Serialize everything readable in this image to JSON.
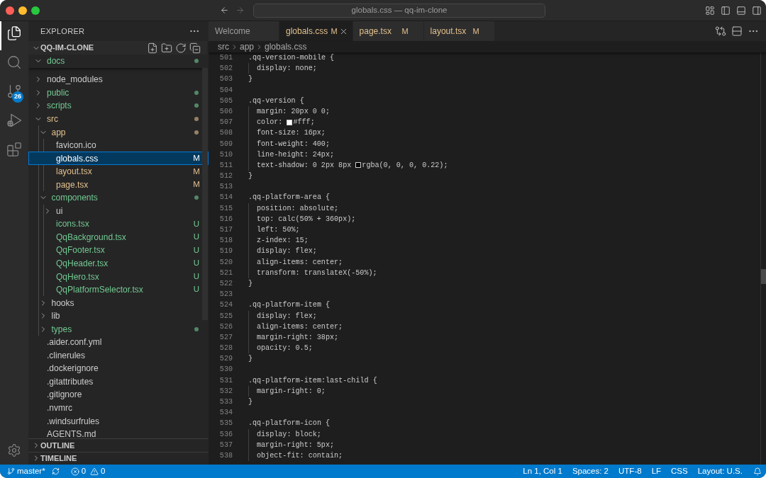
{
  "window": {
    "title": "globals.css — qq-im-clone"
  },
  "activity_bar": {
    "items": [
      {
        "kind": "explorer",
        "selected": true
      },
      {
        "kind": "search",
        "selected": false
      },
      {
        "kind": "scm",
        "selected": false,
        "badge": "26"
      },
      {
        "kind": "debug",
        "selected": false
      },
      {
        "kind": "extensions",
        "selected": false
      }
    ]
  },
  "explorer": {
    "title": "EXPLORER",
    "section": {
      "label": "QQ-IM-CLONE",
      "expanded": true
    },
    "sticky_row": {
      "label": "docs",
      "kind": "folder",
      "expanded": true,
      "color": "#73c991",
      "dot": true,
      "selected": false
    },
    "tree": [
      {
        "label": "node_modules",
        "kind": "folder",
        "expanded": false,
        "dot": false,
        "selected": false
      },
      {
        "label": "public",
        "kind": "folder",
        "expanded": false,
        "color": "#73c991",
        "dot": true,
        "selected": false
      },
      {
        "label": "scripts",
        "kind": "folder",
        "expanded": false,
        "color": "#73c991",
        "dot": true,
        "selected": false
      },
      {
        "label": "src",
        "kind": "folder",
        "expanded": true,
        "color": "#e2c08d",
        "dot": true,
        "selected": false,
        "children": [
          {
            "label": "app",
            "kind": "folder",
            "expanded": true,
            "color": "#e2c08d",
            "dot": true,
            "selected": false,
            "children": [
              {
                "label": "favicon.ico",
                "kind": "file",
                "dot": false,
                "selected": false
              },
              {
                "label": "globals.css",
                "kind": "file",
                "badge": "M",
                "dot": false,
                "selected": true
              },
              {
                "label": "layout.tsx",
                "kind": "file",
                "color": "#e2c08d",
                "badge": "M",
                "dot": false,
                "selected": false
              },
              {
                "label": "page.tsx",
                "kind": "file",
                "color": "#e2c08d",
                "badge": "M",
                "dot": false,
                "selected": false
              }
            ]
          },
          {
            "label": "components",
            "kind": "folder",
            "expanded": true,
            "color": "#73c991",
            "dot": true,
            "selected": false,
            "children": [
              {
                "label": "ui",
                "kind": "folder",
                "expanded": false,
                "dot": false,
                "selected": false
              },
              {
                "label": "icons.tsx",
                "kind": "file",
                "color": "#73c991",
                "badge": "U",
                "dot": false,
                "selected": false
              },
              {
                "label": "QqBackground.tsx",
                "kind": "file",
                "color": "#73c991",
                "badge": "U",
                "dot": false,
                "selected": false
              },
              {
                "label": "QqFooter.tsx",
                "kind": "file",
                "color": "#73c991",
                "badge": "U",
                "dot": false,
                "selected": false
              },
              {
                "label": "QqHeader.tsx",
                "kind": "file",
                "color": "#73c991",
                "badge": "U",
                "dot": false,
                "selected": false
              },
              {
                "label": "QqHero.tsx",
                "kind": "file",
                "color": "#73c991",
                "badge": "U",
                "dot": false,
                "selected": false
              },
              {
                "label": "QqPlatformSelector.tsx",
                "kind": "file",
                "color": "#73c991",
                "badge": "U",
                "dot": false,
                "selected": false
              }
            ]
          },
          {
            "label": "hooks",
            "kind": "folder",
            "expanded": false,
            "dot": false,
            "selected": false
          },
          {
            "label": "lib",
            "kind": "folder",
            "expanded": false,
            "dot": false,
            "selected": false
          },
          {
            "label": "types",
            "kind": "folder",
            "expanded": false,
            "color": "#73c991",
            "dot": true,
            "selected": false
          }
        ]
      },
      {
        "label": ".aider.conf.yml",
        "kind": "file",
        "dot": false,
        "selected": false
      },
      {
        "label": ".clinerules",
        "kind": "file",
        "dot": false,
        "selected": false
      },
      {
        "label": ".dockerignore",
        "kind": "file",
        "dot": false,
        "selected": false
      },
      {
        "label": ".gitattributes",
        "kind": "file",
        "dot": false,
        "selected": false
      },
      {
        "label": ".gitignore",
        "kind": "file",
        "dot": false,
        "selected": false
      },
      {
        "label": ".nvmrc",
        "kind": "file",
        "dot": false,
        "selected": false
      },
      {
        "label": ".windsurfrules",
        "kind": "file",
        "dot": false,
        "selected": false
      },
      {
        "label": "AGENTS.md",
        "kind": "file",
        "dot": false,
        "selected": false
      }
    ],
    "panels": [
      {
        "label": "OUTLINE",
        "expanded": false
      },
      {
        "label": "TIMELINE",
        "expanded": false
      }
    ]
  },
  "editor": {
    "tabs": [
      {
        "label": "Welcome",
        "color": "#9d9d9d",
        "selected": false
      },
      {
        "label": "globals.css",
        "color": "#e2c08d",
        "badge": "M",
        "selected": true
      },
      {
        "label": "page.tsx",
        "color": "#e2c08d",
        "badge": "M",
        "selected": false
      },
      {
        "label": "layout.tsx",
        "color": "#e2c08d",
        "badge": "M",
        "selected": false
      }
    ],
    "breadcrumb": [
      "src",
      "app",
      "globals.css"
    ],
    "lines": [
      {
        "number": "501",
        "code": ".qq-version-mobile {",
        "children": [
          {
            "number": "502",
            "code": "display: none;"
          }
        ]
      },
      {
        "number": "503",
        "code": "}"
      },
      {
        "number": "504"
      },
      {
        "number": "505",
        "code": ".qq-version {",
        "children": [
          {
            "number": "506",
            "code": "margin: 20px 0 0;"
          },
          {
            "number": "507",
            "parts": [
              {
                "kind": "text",
                "text": "color: "
              },
              {
                "kind": "swatch",
                "color": "#ffffff"
              },
              {
                "kind": "text",
                "text": "#fff;"
              }
            ]
          },
          {
            "number": "508",
            "code": "font-size: 16px;"
          },
          {
            "number": "509",
            "code": "font-weight: 400;"
          },
          {
            "number": "510",
            "code": "line-height: 24px;"
          },
          {
            "number": "511",
            "parts": [
              {
                "kind": "text",
                "text": "text-shadow: 0 2px 8px "
              },
              {
                "kind": "swatch",
                "color": "#000000"
              },
              {
                "kind": "text",
                "text": "rgba(0, 0, 0, 0.22);"
              }
            ]
          }
        ]
      },
      {
        "number": "512",
        "code": "}"
      },
      {
        "number": "513"
      },
      {
        "number": "514",
        "code": ".qq-platform-area {",
        "children": [
          {
            "number": "515",
            "code": "position: absolute;"
          },
          {
            "number": "516",
            "code": "top: calc(50% + 360px);"
          },
          {
            "number": "517",
            "code": "left: 50%;"
          },
          {
            "number": "518",
            "code": "z-index: 15;"
          },
          {
            "number": "519",
            "code": "display: flex;"
          },
          {
            "number": "520",
            "code": "align-items: center;"
          },
          {
            "number": "521",
            "code": "transform: translateX(-50%);"
          }
        ]
      },
      {
        "number": "522",
        "code": "}"
      },
      {
        "number": "523"
      },
      {
        "number": "524",
        "code": ".qq-platform-item {",
        "children": [
          {
            "number": "525",
            "code": "display: flex;"
          },
          {
            "number": "526",
            "code": "align-items: center;"
          },
          {
            "number": "527",
            "code": "margin-right: 38px;"
          },
          {
            "number": "528",
            "code": "opacity: 0.5;"
          }
        ]
      },
      {
        "number": "529",
        "code": "}"
      },
      {
        "number": "530"
      },
      {
        "number": "531",
        "code": ".qq-platform-item:last-child {",
        "children": [
          {
            "number": "532",
            "code": "margin-right: 0;"
          }
        ]
      },
      {
        "number": "533",
        "code": "}"
      },
      {
        "number": "534"
      },
      {
        "number": "535",
        "code": ".qq-platform-icon {",
        "children": [
          {
            "number": "536",
            "code": "display: block;"
          },
          {
            "number": "537",
            "code": "margin-right: 5px;"
          },
          {
            "number": "538",
            "code": "object-fit: contain;"
          }
        ]
      }
    ]
  },
  "status_bar": {
    "branch": "master*",
    "errors": "0",
    "warnings": "0",
    "right": [
      "Ln 1, Col 1",
      "Spaces: 2",
      "UTF-8",
      "LF",
      "CSS",
      "Layout: U.S."
    ]
  }
}
